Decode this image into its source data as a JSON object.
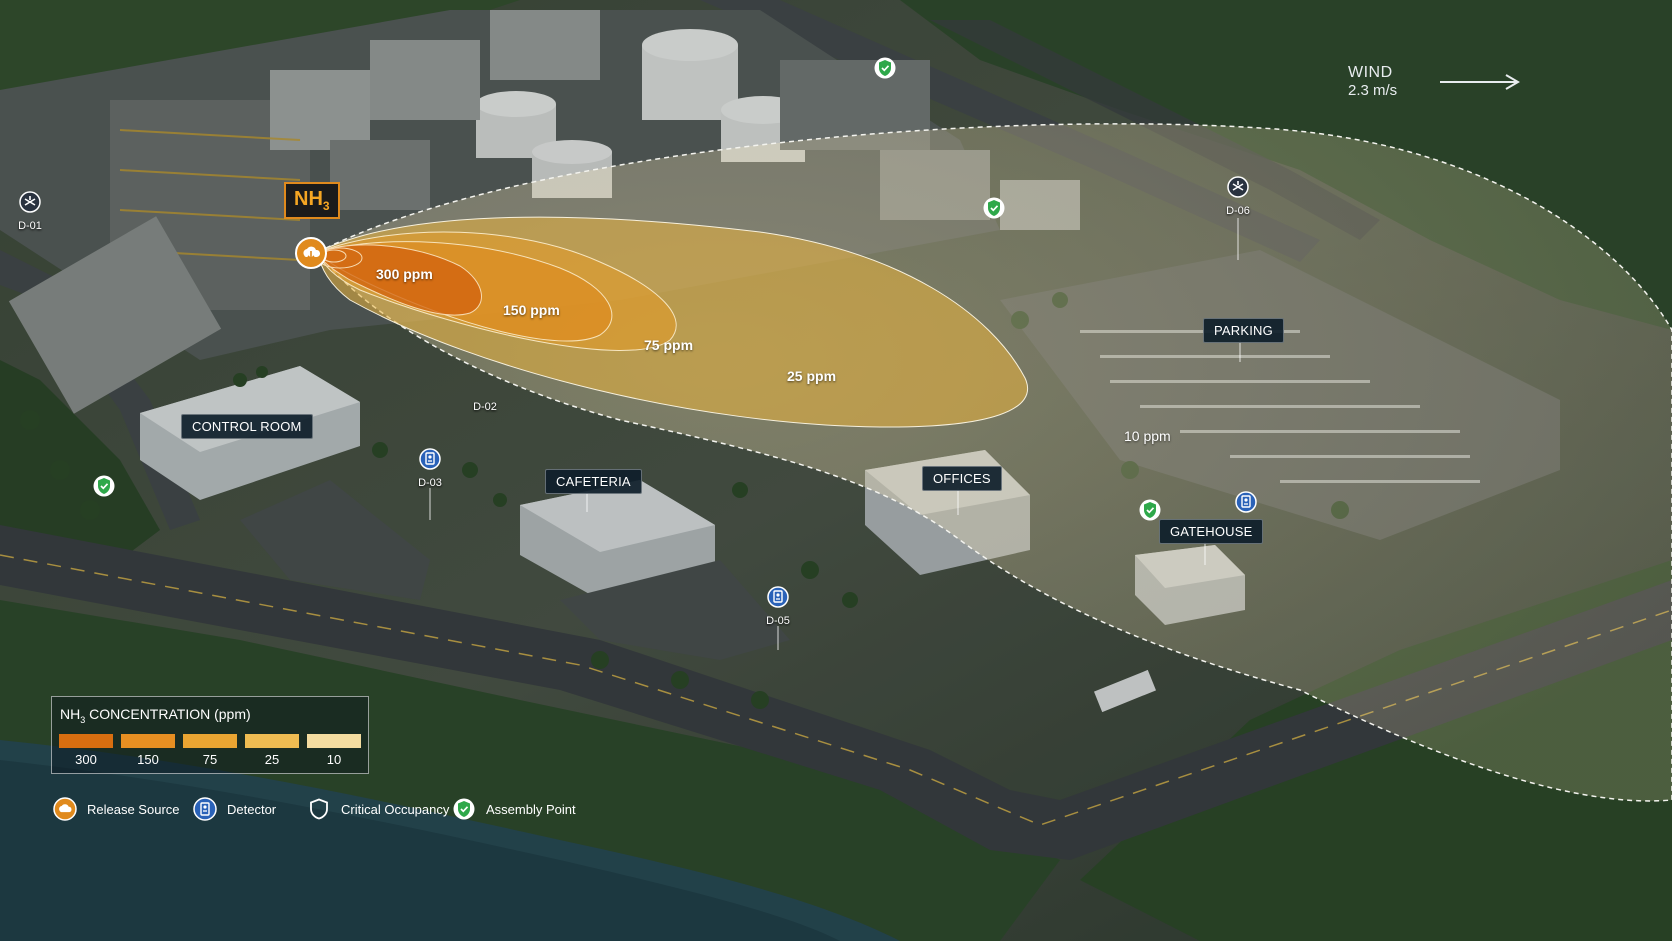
{
  "release": {
    "chemical_main": "NH",
    "chemical_sub": "3",
    "icon": "release-source-icon"
  },
  "wind": {
    "label": "WIND",
    "speed": "2.3 m/s",
    "icon": "arrow-right-icon"
  },
  "contours": [
    {
      "label": "300 ppm",
      "value": 300,
      "color": "#d86e10"
    },
    {
      "label": "150 ppm",
      "value": 150,
      "color": "#e78f22"
    },
    {
      "label": "75 ppm",
      "value": 75,
      "color": "#eaa532"
    },
    {
      "label": "25 ppm",
      "value": 25,
      "color": "#efbc52"
    },
    {
      "label": "10 ppm",
      "value": 10,
      "color": "#f1d99a"
    }
  ],
  "buildings": {
    "control_room": "CONTROL ROOM",
    "cafeteria": "CAFETERIA",
    "offices": "OFFICES",
    "parking": "PARKING",
    "gatehouse": "GATEHOUSE"
  },
  "detectors": [
    {
      "id": "D-01",
      "icon": "valve-detector-icon"
    },
    {
      "id": "D-02",
      "icon": "detector-icon"
    },
    {
      "id": "D-03",
      "icon": "detector-icon"
    },
    {
      "id": "D-05",
      "icon": "detector-icon"
    },
    {
      "id": "D-06",
      "icon": "valve-detector-icon"
    }
  ],
  "legend": {
    "title_main": "NH",
    "title_sub": "3",
    "title_rest": " CONCENTRATION (ppm)",
    "scale": [
      {
        "label": "300",
        "color": "#d86e10"
      },
      {
        "label": "150",
        "color": "#e78f22"
      },
      {
        "label": "75",
        "color": "#eaa532"
      },
      {
        "label": "25",
        "color": "#efbc52"
      },
      {
        "label": "10",
        "color": "#f4dca0"
      }
    ],
    "keys": {
      "release_source": "Release Source",
      "detector": "Detector",
      "critical_occupancy": "Critical Occupancy",
      "assembly_point": "Assembly Point"
    }
  },
  "colors": {
    "assembly_green": "#2ea84a",
    "release_orange": "#e08a1d",
    "detector_blue": "#2a62b8"
  }
}
